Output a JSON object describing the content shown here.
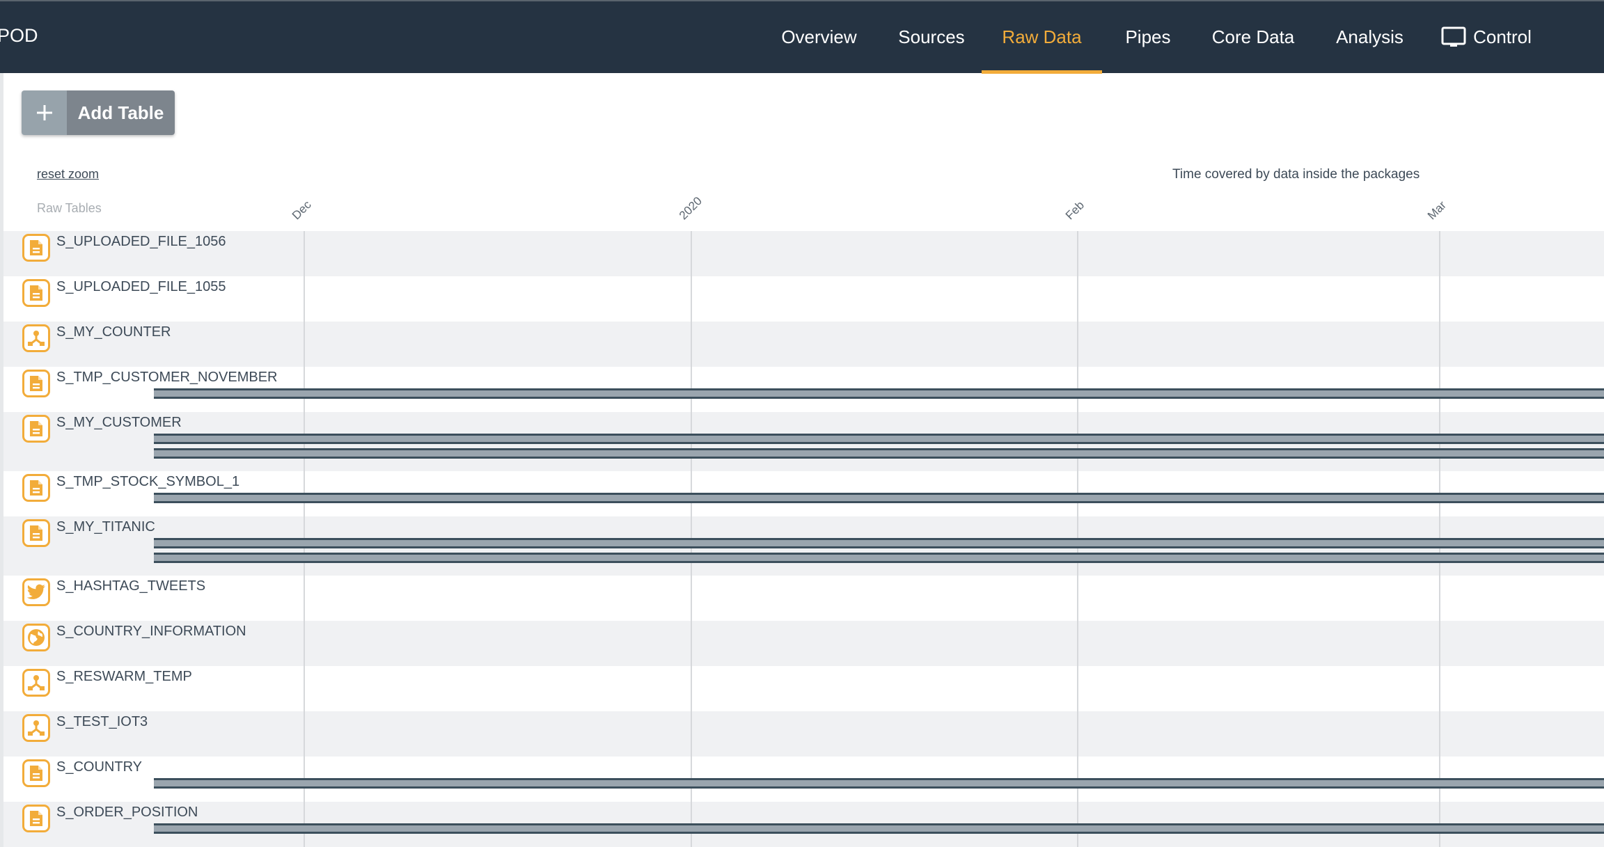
{
  "header": {
    "brand": "POD",
    "nav": [
      {
        "label": "Overview",
        "active": false
      },
      {
        "label": "Sources",
        "active": false
      },
      {
        "label": "Raw Data",
        "active": true
      },
      {
        "label": "Pipes",
        "active": false
      },
      {
        "label": "Core Data",
        "active": false
      },
      {
        "label": "Analysis",
        "active": false
      },
      {
        "label": "Control",
        "active": false,
        "icon": "monitor-icon"
      }
    ]
  },
  "toolbar": {
    "add_table_label": "Add Table",
    "add_icon": "plus-icon"
  },
  "timeline": {
    "reset_zoom": "reset zoom",
    "column_header": "Raw Tables",
    "title": "Time covered by data inside the packages"
  },
  "colors": {
    "accent": "#f2ac3a",
    "header_bg": "#253342",
    "bar_fill": "#9aa5ae",
    "bar_border": "#3c4f5c"
  },
  "chart_data": {
    "type": "timeline",
    "title": "Time covered by data inside the packages",
    "x_range": [
      "2019-11-07",
      "2020-03-14"
    ],
    "ticks": [
      {
        "label": "Dec",
        "date": "2019-12-01"
      },
      {
        "label": "2020",
        "date": "2020-01-01"
      },
      {
        "label": "Feb",
        "date": "2020-02-01"
      },
      {
        "label": "Mar",
        "date": "2020-03-01"
      }
    ],
    "rows": [
      {
        "name": "S_UPLOADED_FILE_1056",
        "icon": "file",
        "packages": []
      },
      {
        "name": "S_UPLOADED_FILE_1055",
        "icon": "file",
        "packages": []
      },
      {
        "name": "S_MY_COUNTER",
        "icon": "network",
        "packages": []
      },
      {
        "name": "S_TMP_CUSTOMER_NOVEMBER",
        "icon": "file",
        "packages": [
          {
            "start": "2019-11-19",
            "end": "2020-03-14"
          }
        ]
      },
      {
        "name": "S_MY_CUSTOMER",
        "icon": "file",
        "packages": [
          {
            "start": "2019-11-19",
            "end": "2020-03-14"
          },
          {
            "start": "2019-11-19",
            "end": "2020-03-14"
          }
        ]
      },
      {
        "name": "S_TMP_STOCK_SYMBOL_1",
        "icon": "file",
        "packages": [
          {
            "start": "2019-11-19",
            "end": "2020-03-14"
          }
        ]
      },
      {
        "name": "S_MY_TITANIC",
        "icon": "file",
        "packages": [
          {
            "start": "2019-11-19",
            "end": "2020-03-14"
          },
          {
            "start": "2019-11-19",
            "end": "2020-03-14"
          }
        ]
      },
      {
        "name": "S_HASHTAG_TWEETS",
        "icon": "twitter",
        "packages": []
      },
      {
        "name": "S_COUNTRY_INFORMATION",
        "icon": "globe",
        "packages": []
      },
      {
        "name": "S_RESWARM_TEMP",
        "icon": "network",
        "packages": []
      },
      {
        "name": "S_TEST_IOT3",
        "icon": "network",
        "packages": []
      },
      {
        "name": "S_COUNTRY",
        "icon": "file",
        "packages": [
          {
            "start": "2019-11-19",
            "end": "2020-03-14"
          }
        ]
      },
      {
        "name": "S_ORDER_POSITION",
        "icon": "file",
        "packages": [
          {
            "start": "2019-11-19",
            "end": "2020-03-14"
          }
        ]
      }
    ]
  }
}
